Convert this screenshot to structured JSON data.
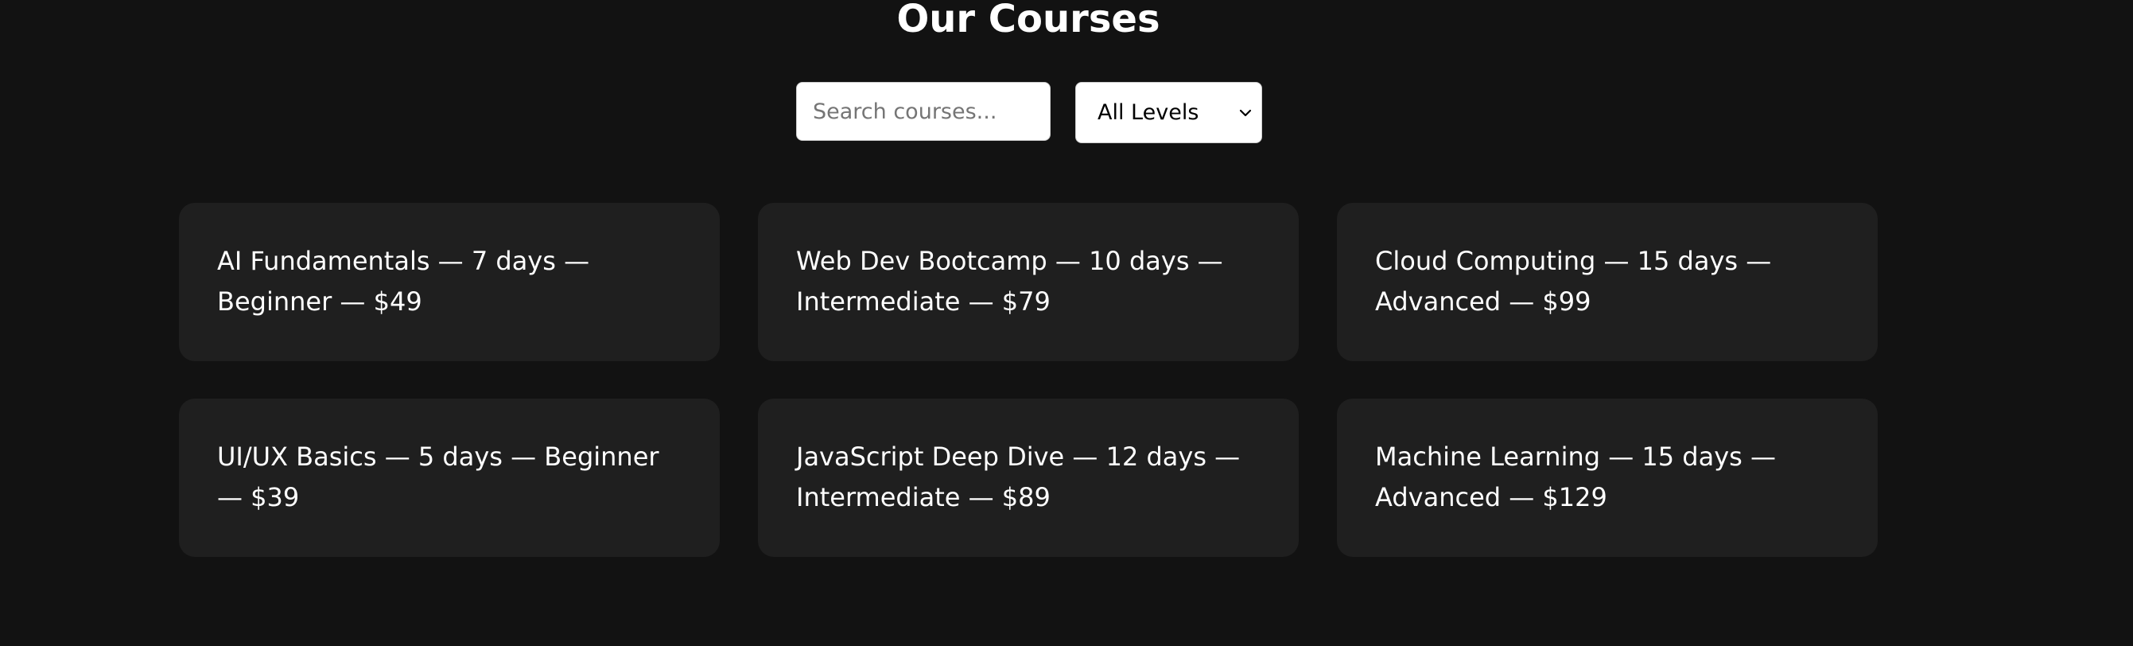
{
  "page": {
    "title": "Our Courses"
  },
  "filters": {
    "search_placeholder": "Search courses...",
    "level_selected": "All Levels"
  },
  "courses": [
    {
      "text": "AI Fundamentals — 7 days — Beginner — $49"
    },
    {
      "text": "Web Dev Bootcamp — 10 days — Intermediate — $79"
    },
    {
      "text": "Cloud Computing — 15 days — Advanced — $99"
    },
    {
      "text": "UI/UX Basics — 5 days — Beginner — $39"
    },
    {
      "text": "JavaScript Deep Dive — 12 days — Intermediate — $89"
    },
    {
      "text": "Machine Learning — 15 days — Advanced — $129"
    }
  ],
  "icons": {
    "select_chevron": "chevron-down-icon"
  },
  "colors": {
    "background": "#121212",
    "card": "#1f1f1f",
    "text": "#ffffff"
  }
}
